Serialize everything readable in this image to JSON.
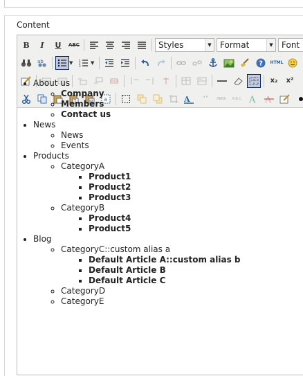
{
  "label": "Content",
  "toolbar": {
    "styles_select": "Styles",
    "format_select": "Format",
    "font_select": "Font",
    "bold": "B",
    "italic": "I",
    "underline": "U",
    "strike": "ABC",
    "html": "HTML",
    "subscript": "x₂",
    "superscript": "x²",
    "cite": "“”",
    "abbr": "ABBR",
    "acronym": "A.B.C."
  },
  "tree": [
    {
      "label": "About us",
      "children": [
        {
          "label": "Company",
          "bold": true
        },
        {
          "label": "Members",
          "bold": true
        },
        {
          "label": "Contact us",
          "bold": true
        }
      ]
    },
    {
      "label": "News",
      "children": [
        {
          "label": "News"
        },
        {
          "label": "Events"
        }
      ]
    },
    {
      "label": "Products",
      "children": [
        {
          "label": "CategoryA",
          "children": [
            {
              "label": "Product1"
            },
            {
              "label": "Product2"
            },
            {
              "label": "Product3"
            }
          ]
        },
        {
          "label": "CategoryB",
          "children": [
            {
              "label": "Product4"
            },
            {
              "label": "Product5"
            }
          ]
        }
      ]
    },
    {
      "label": "Blog",
      "children": [
        {
          "label": "CategoryC::custom alias a",
          "children": [
            {
              "label": "Default Article A::custom alias b"
            },
            {
              "label": "Default Article B"
            },
            {
              "label": "Default Article C"
            }
          ]
        },
        {
          "label": "CategoryD"
        },
        {
          "label": "CategoryE"
        }
      ]
    }
  ]
}
